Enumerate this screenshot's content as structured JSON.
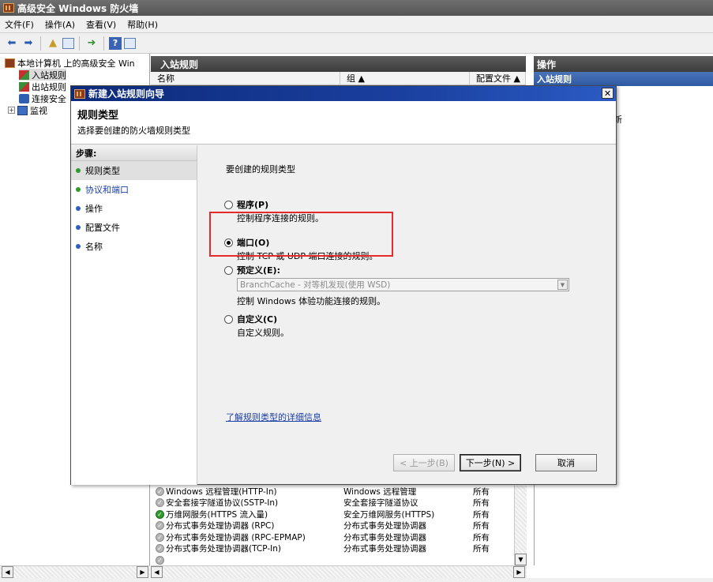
{
  "window": {
    "title": "高级安全 Windows 防火墙"
  },
  "menu": [
    "文件(F)",
    "操作(A)",
    "查看(V)",
    "帮助(H)"
  ],
  "toolbar": {
    "help_label": "?"
  },
  "tree": {
    "root": "本地计算机 上的高级安全 Win",
    "items": [
      "入站规则",
      "出站规则",
      "连接安全",
      "监视"
    ]
  },
  "middle": {
    "header": "入站规则",
    "columns": [
      "名称",
      "组 ▲",
      "配置文件 ▲"
    ],
    "rows": [
      {
        "name": "Windows 远程管理(HTTP-In)",
        "group": "Windows 远程管理",
        "profile": "所有",
        "status": "gray"
      },
      {
        "name": "安全套接字隧道协议(SSTP-In)",
        "group": "安全套接字隧道协议",
        "profile": "所有",
        "status": "gray"
      },
      {
        "name": "万维网服务(HTTPS 流入量)",
        "group": "安全万维网服务(HTTPS)",
        "profile": "所有",
        "status": "green"
      },
      {
        "name": "分布式事务处理协调器 (RPC)",
        "group": "分布式事务处理协调器",
        "profile": "所有",
        "status": "gray"
      },
      {
        "name": "分布式事务处理协调器 (RPC-EPMAP)",
        "group": "分布式事务处理协调器",
        "profile": "所有",
        "status": "gray"
      },
      {
        "name": "分布式事务处理协调器(TCP-In)",
        "group": "分布式事务处理协调器",
        "profile": "所有",
        "status": "gray"
      },
      {
        "name": "",
        "group": "",
        "profile": "",
        "status": "gray"
      }
    ]
  },
  "actions": {
    "header": "操作",
    "sub": "入站规则",
    "partial": "新"
  },
  "wizard": {
    "title": "新建入站规则向导",
    "heading": "规则类型",
    "subheading": "选择要创建的防火墙规则类型",
    "steps_title": "步骤:",
    "steps": [
      {
        "label": "规则类型",
        "dot": "green",
        "active": true
      },
      {
        "label": "协议和端口",
        "dot": "green",
        "active": false
      },
      {
        "label": "操作",
        "dot": "blue",
        "active": false
      },
      {
        "label": "配置文件",
        "dot": "blue",
        "active": false
      },
      {
        "label": "名称",
        "dot": "blue",
        "active": false
      }
    ],
    "question": "要创建的规则类型",
    "options": [
      {
        "label": "程序(P)",
        "desc": "控制程序连接的规则。",
        "selected": false
      },
      {
        "label": "端口(O)",
        "desc": "控制 TCP 或 UDP 端口连接的规则。",
        "selected": true
      },
      {
        "label": "预定义(E):",
        "desc": "控制 Windows 体验功能连接的规则。",
        "selected": false
      },
      {
        "label": "自定义(C)",
        "desc": "自定义规则。",
        "selected": false
      }
    ],
    "predefined_value": "BranchCache - 对等机发现(使用 WSD)",
    "learn_more": "了解规则类型的详细信息",
    "buttons": {
      "back": "< 上一步(B)",
      "next": "下一步(N) >",
      "cancel": "取消"
    }
  },
  "colors": {
    "highlight": "#e52a2a",
    "link": "#1a3fa8",
    "title_bar": "#0c2a7a"
  }
}
